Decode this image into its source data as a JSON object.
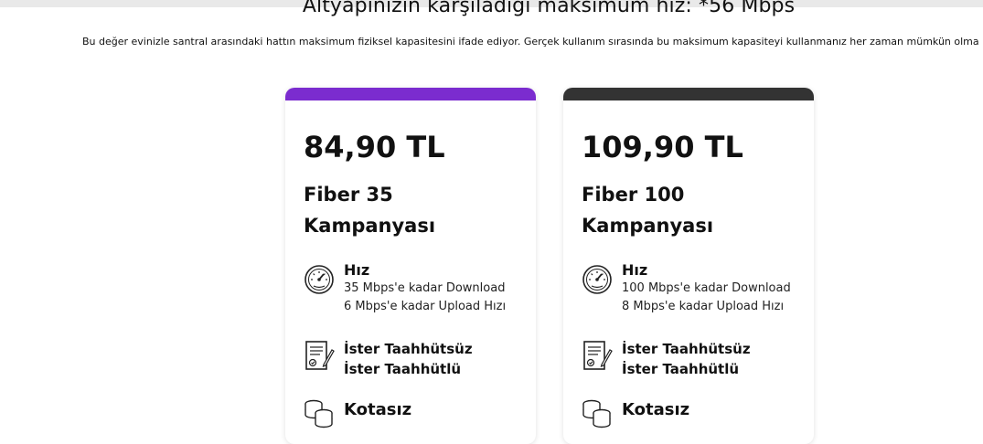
{
  "header": {
    "title": "Altyapınızın karşıladığı maksimum hız: *56 Mbps",
    "subtitle": "Bu değer evinizle santral arasındaki hattın maksimum fiziksel kapasitesini ifade ediyor. Gerçek kullanım sırasında bu maksimum kapasiteyi kullanmanız her zaman mümkün olma"
  },
  "plans": [
    {
      "accent": "#7b2ccf",
      "price": "84,90 TL",
      "name_line1": "Fiber 35",
      "name_line2": "Kampanyası",
      "speed_title": "Hız",
      "download": "35 Mbps'e kadar Download",
      "upload": "6 Mbps'e kadar Upload Hızı",
      "commit1": "İster Taahhütsüz",
      "commit2": "İster Taahhütlü",
      "quota": "Kotasız"
    },
    {
      "accent": "#333333",
      "price": "109,90 TL",
      "name_line1": "Fiber 100",
      "name_line2": "Kampanyası",
      "speed_title": "Hız",
      "download": "100 Mbps'e kadar Download",
      "upload": "8 Mbps'e kadar Upload Hızı",
      "commit1": "İster Taahhütsüz",
      "commit2": "İster Taahhütlü",
      "quota": "Kotasız"
    }
  ],
  "icons": {
    "speed": "speedometer-icon",
    "commit": "contract-document-icon",
    "quota": "coin-stack-icon"
  }
}
